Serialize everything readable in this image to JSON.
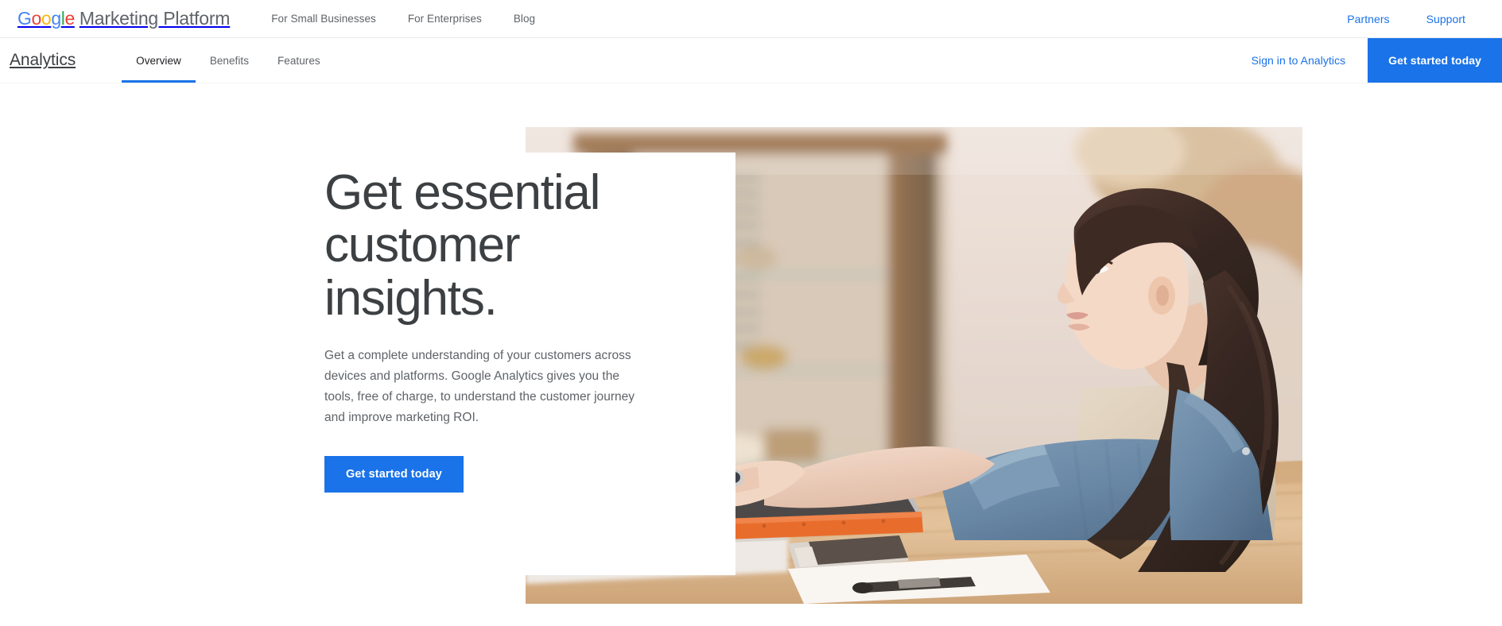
{
  "global_header": {
    "brand": {
      "google_letters": [
        {
          "char": "G",
          "color": "#4285F4"
        },
        {
          "char": "o",
          "color": "#EA4335"
        },
        {
          "char": "o",
          "color": "#FBBC05"
        },
        {
          "char": "g",
          "color": "#4285F4"
        },
        {
          "char": "l",
          "color": "#34A853"
        },
        {
          "char": "e",
          "color": "#EA4335"
        }
      ],
      "suffix": "Marketing Platform"
    },
    "nav": [
      {
        "label": "For Small Businesses"
      },
      {
        "label": "For Enterprises"
      },
      {
        "label": "Blog"
      }
    ],
    "right_links": [
      {
        "label": "Partners"
      },
      {
        "label": "Support"
      }
    ]
  },
  "product_header": {
    "product_name": "Analytics",
    "tabs": [
      {
        "label": "Overview",
        "active": true
      },
      {
        "label": "Benefits",
        "active": false
      },
      {
        "label": "Features",
        "active": false
      }
    ],
    "signin_label": "Sign in to Analytics",
    "cta_label": "Get started today"
  },
  "hero": {
    "title": "Get essential customer insights.",
    "body": "Get a complete understanding of your customers across devices and platforms. Google Analytics gives you the tools, free of charge, to understand the customer journey and improve marketing ROI.",
    "cta_label": "Get started today",
    "photo_alt": "Woman with dark hair in a denim shirt and apron typing on a laptop at a wooden counter in an antique shop"
  },
  "colors": {
    "accent_blue": "#1a73e8",
    "link_blue": "#1a73e8",
    "text_primary": "#202124",
    "text_secondary": "#5f6368",
    "heading": "#3c4043",
    "google_blue": "#4285F4",
    "google_red": "#EA4335",
    "google_yellow": "#FBBC05",
    "google_green": "#34A853"
  }
}
